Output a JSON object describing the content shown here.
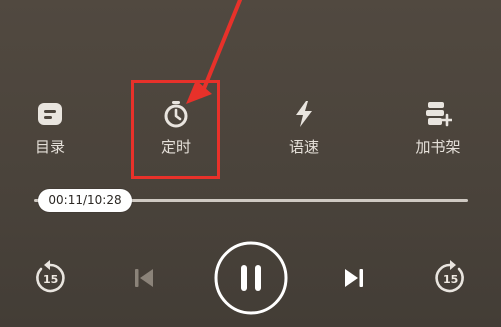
{
  "features": [
    {
      "id": "toc",
      "label": "目录",
      "icon": "catalog-icon"
    },
    {
      "id": "timer",
      "label": "定时",
      "icon": "timer-icon"
    },
    {
      "id": "speed",
      "label": "语速",
      "icon": "lightning-icon"
    },
    {
      "id": "shelf",
      "label": "加书架",
      "icon": "add-to-shelf-icon"
    }
  ],
  "progress": {
    "time_label": "00:11/10:28"
  },
  "controls": {
    "rewind_seconds": "15",
    "forward_seconds": "15",
    "play_state_icon": "pause-icon"
  },
  "annotation": {
    "highlight_color": "#e8312a",
    "target": "timer"
  },
  "colors": {
    "background": "#4a433b",
    "foreground": "#e9e5df",
    "disabled": "#8b8379"
  }
}
